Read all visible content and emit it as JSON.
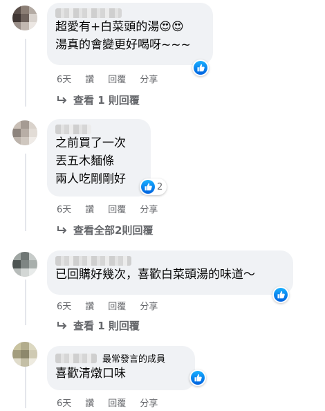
{
  "comments": [
    {
      "text_lines": [
        "超愛有+白菜頭的湯😍😍",
        "湯真的會變更好喝呀~~~"
      ],
      "like_count": "",
      "actions": {
        "time": "6天",
        "like": "讚",
        "reply": "回覆",
        "share": "分享"
      },
      "view_replies": "查看 1 則回覆"
    },
    {
      "text_lines": [
        "之前買了一次",
        "丟五木麵條",
        "兩人吃剛剛好"
      ],
      "like_count": "2",
      "actions": {
        "time": "6天",
        "like": "讚",
        "reply": "回覆",
        "share": "分享"
      },
      "view_replies": "查看全部2則回覆"
    },
    {
      "text_lines": [
        "已回購好幾次，喜歡白菜頭湯的味道～"
      ],
      "like_count": "",
      "actions": {
        "time": "6天",
        "like": "讚",
        "reply": "回覆",
        "share": "分享"
      },
      "view_replies": "查看 1 則回覆"
    },
    {
      "badge": "最常發言的成員",
      "text_lines": [
        "喜歡清燉口味"
      ],
      "like_count": "",
      "actions": {
        "time": "6天",
        "like": "讚",
        "reply": "回覆",
        "share": "分享"
      }
    }
  ],
  "colors": {
    "bubble": "#f0f2f5",
    "meta_text": "#65676b",
    "like_blue": "#1877f2"
  },
  "icons": {
    "like": "thumbs-up-icon",
    "reply_arrow": "reply-arrow-icon"
  }
}
